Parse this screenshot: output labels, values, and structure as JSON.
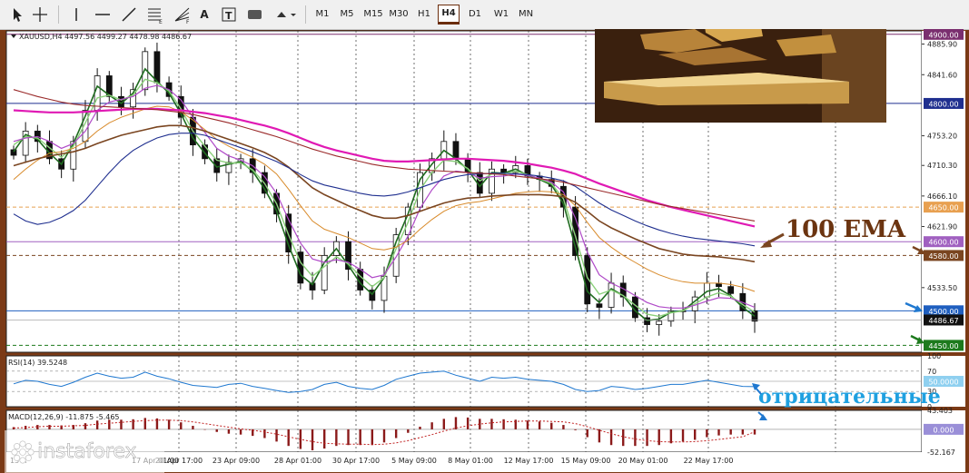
{
  "toolbar": {
    "tools": [
      "cursor-icon",
      "crosshair-icon",
      "vertical-line-icon",
      "horizontal-line-icon",
      "trendline-icon",
      "fibonacci-icon",
      "fibonacci-fan-icon",
      "text-icon",
      "text-label-icon",
      "rectangle-icon",
      "shapes-menu-icon"
    ],
    "timeframes": [
      "M1",
      "M5",
      "M15",
      "M30",
      "H1",
      "H4",
      "D1",
      "W1",
      "MN"
    ],
    "active_timeframe": "H4"
  },
  "chart_data": [
    {
      "type": "line",
      "title": "XAUUSD,H4  4497.56 4499.27 4478.98 4486.67",
      "subtitle": "",
      "xlabel": "",
      "ylabel": "",
      "ylim": [
        4440,
        4905
      ],
      "grid": true,
      "y_ticks": [
        "4900.00",
        "4885.90",
        "4841.60",
        "4800.00",
        "4753.20",
        "4710.30",
        "4666.10",
        "4650.00",
        "4621.90",
        "4600.00",
        "4580.00",
        "4533.50",
        "4500.00",
        "4486.67",
        "4450.00"
      ],
      "x_ticks": [
        "20 Apr 17:00",
        "23 Apr 09:00",
        "28 Apr 01:00",
        "30 Apr 17:00",
        "5 May 09:00",
        "8 May 01:00",
        "12 May 17:00",
        "15 May 09:00",
        "20 May 01:00",
        "22 May 17:00"
      ],
      "x_ticks_partial": [
        "15 A",
        "17 Apr 01:00"
      ],
      "horizontal_levels": [
        {
          "value": 4900,
          "label": "4900.00",
          "color": "#7a2f6f",
          "style": "solid"
        },
        {
          "value": 4800,
          "label": "4800.00",
          "color": "#1f2f8f",
          "style": "solid"
        },
        {
          "value": 4650,
          "label": "4650.00",
          "color": "#e8a050",
          "style": "dashed"
        },
        {
          "value": 4600,
          "label": "4600.00",
          "color": "#a060c0",
          "style": "solid"
        },
        {
          "value": 4580,
          "label": "4580.00",
          "color": "#7a4520",
          "style": "dashed"
        },
        {
          "value": 4500,
          "label": "4500.00",
          "color": "#1f5fbf",
          "style": "solid"
        },
        {
          "value": 4450,
          "label": "4450.00",
          "color": "#1d7a1d",
          "style": "dashed"
        }
      ],
      "current_price": {
        "value": 4486.67,
        "label": "4486.67"
      },
      "series": [
        {
          "values": [
            4725,
            4760,
            4745,
            4720,
            4705,
            4745,
            4790,
            4840,
            4810,
            4795,
            4820,
            4875,
            4830,
            4810,
            4780,
            4740,
            4720,
            4700,
            4715,
            4720,
            4700,
            4670,
            4640,
            4585,
            4540,
            4530,
            4580,
            4600,
            4560,
            4530,
            4515,
            4550,
            4610,
            4650,
            4700,
            4720,
            4745,
            4720,
            4700,
            4670,
            4705,
            4700,
            4710,
            4695,
            4690,
            4680,
            4650,
            4580,
            4510,
            4505,
            4540,
            4520,
            4490,
            4480,
            4485,
            4500,
            4500,
            4520,
            4540,
            4535,
            4525,
            4500,
            4485
          ],
          "color": "#111111"
        },
        {
          "values": [
            4730,
            4755,
            4748,
            4728,
            4712,
            4742,
            4782,
            4825,
            4812,
            4800,
            4815,
            4850,
            4832,
            4815,
            4785,
            4750,
            4728,
            4708,
            4712,
            4716,
            4702,
            4676,
            4645,
            4595,
            4552,
            4538,
            4570,
            4590,
            4566,
            4540,
            4524,
            4548,
            4600,
            4640,
            4690,
            4712,
            4732,
            4720,
            4704,
            4680,
            4700,
            4699,
            4705,
            4696,
            4690,
            4682,
            4655,
            4592,
            4528,
            4512,
            4532,
            4522,
            4500,
            4486,
            4488,
            4498,
            4500,
            4514,
            4528,
            4532,
            4522,
            4505,
            4492
          ],
          "color": "#1f6b1f"
        },
        {
          "values": [
            4740,
            4752,
            4750,
            4736,
            4722,
            4738,
            4772,
            4808,
            4812,
            4805,
            4812,
            4835,
            4830,
            4818,
            4792,
            4760,
            4738,
            4718,
            4714,
            4714,
            4704,
            4684,
            4655,
            4610,
            4570,
            4550,
            4564,
            4578,
            4568,
            4550,
            4535,
            4548,
            4590,
            4628,
            4675,
            4700,
            4718,
            4716,
            4706,
            4688,
            4698,
            4698,
            4702,
            4697,
            4691,
            4684,
            4662,
            4608,
            4548,
            4524,
            4530,
            4522,
            4508,
            4495,
            4492,
            4497,
            4500,
            4510,
            4520,
            4526,
            4521,
            4509,
            4498
          ],
          "color": "#8ad07a"
        },
        {
          "values": [
            4745,
            4750,
            4752,
            4745,
            4735,
            4742,
            4760,
            4790,
            4802,
            4806,
            4810,
            4822,
            4826,
            4820,
            4805,
            4780,
            4758,
            4735,
            4724,
            4718,
            4710,
            4694,
            4670,
            4632,
            4598,
            4575,
            4570,
            4574,
            4570,
            4560,
            4548,
            4552,
            4578,
            4608,
            4648,
            4675,
            4695,
            4702,
            4700,
            4692,
            4694,
            4695,
            4698,
            4696,
            4692,
            4686,
            4672,
            4634,
            4585,
            4552,
            4540,
            4532,
            4522,
            4512,
            4506,
            4504,
            4504,
            4508,
            4514,
            4519,
            4518,
            4512,
            4505
          ],
          "color": "#b04ac8"
        },
        {
          "values": [
            4690,
            4705,
            4718,
            4728,
            4730,
            4735,
            4745,
            4760,
            4772,
            4780,
            4786,
            4792,
            4796,
            4795,
            4788,
            4776,
            4762,
            4748,
            4738,
            4730,
            4722,
            4712,
            4698,
            4676,
            4652,
            4630,
            4618,
            4612,
            4606,
            4598,
            4590,
            4588,
            4592,
            4602,
            4618,
            4632,
            4644,
            4652,
            4656,
            4658,
            4662,
            4666,
            4670,
            4672,
            4673,
            4672,
            4668,
            4652,
            4628,
            4606,
            4592,
            4580,
            4570,
            4560,
            4552,
            4546,
            4542,
            4540,
            4540,
            4540,
            4538,
            4534,
            4528
          ],
          "color": "#d88a2a"
        },
        {
          "values": [
            4710,
            4715,
            4720,
            4724,
            4727,
            4730,
            4735,
            4742,
            4748,
            4754,
            4758,
            4762,
            4766,
            4768,
            4768,
            4765,
            4760,
            4754,
            4748,
            4742,
            4736,
            4729,
            4720,
            4708,
            4693,
            4678,
            4668,
            4660,
            4652,
            4645,
            4638,
            4634,
            4634,
            4638,
            4644,
            4650,
            4656,
            4660,
            4663,
            4664,
            4666,
            4667,
            4668,
            4668,
            4668,
            4667,
            4665,
            4657,
            4644,
            4630,
            4620,
            4612,
            4604,
            4597,
            4590,
            4586,
            4582,
            4580,
            4579,
            4578,
            4576,
            4574,
            4571
          ],
          "color": "#7a4520"
        },
        {
          "values": [
            4640,
            4630,
            4625,
            4628,
            4635,
            4645,
            4660,
            4680,
            4700,
            4718,
            4732,
            4742,
            4750,
            4755,
            4757,
            4757,
            4754,
            4748,
            4742,
            4736,
            4730,
            4723,
            4716,
            4707,
            4697,
            4688,
            4682,
            4678,
            4674,
            4670,
            4667,
            4666,
            4668,
            4672,
            4678,
            4684,
            4690,
            4694,
            4697,
            4698,
            4699,
            4699,
            4698,
            4697,
            4695,
            4692,
            4688,
            4680,
            4668,
            4656,
            4646,
            4638,
            4630,
            4623,
            4617,
            4612,
            4608,
            4605,
            4603,
            4601,
            4599,
            4597,
            4594
          ],
          "color": "#1f2f8f"
        },
        {
          "values": [
            4790,
            4789,
            4788,
            4787,
            4787,
            4787,
            4788,
            4789,
            4790,
            4791,
            4792,
            4792,
            4792,
            4791,
            4790,
            4788,
            4786,
            4783,
            4780,
            4776,
            4772,
            4768,
            4763,
            4757,
            4750,
            4743,
            4737,
            4732,
            4728,
            4724,
            4720,
            4717,
            4716,
            4716,
            4717,
            4718,
            4719,
            4720,
            4720,
            4719,
            4718,
            4717,
            4715,
            4713,
            4710,
            4707,
            4703,
            4698,
            4691,
            4684,
            4678,
            4672,
            4666,
            4660,
            4655,
            4650,
            4646,
            4642,
            4638,
            4634,
            4630,
            4626,
            4622
          ],
          "color": "#e01ab4"
        },
        {
          "values": [
            4820,
            4815,
            4810,
            4806,
            4802,
            4799,
            4797,
            4796,
            4795,
            4794,
            4793,
            4792,
            4791,
            4789,
            4787,
            4784,
            4780,
            4776,
            4772,
            4767,
            4762,
            4757,
            4752,
            4746,
            4740,
            4734,
            4729,
            4724,
            4720,
            4716,
            4712,
            4709,
            4707,
            4705,
            4704,
            4703,
            4702,
            4701,
            4700,
            4699,
            4698,
            4697,
            4695,
            4693,
            4691,
            4689,
            4686,
            4682,
            4678,
            4674,
            4670,
            4666,
            4662,
            4658,
            4654,
            4651,
            4648,
            4645,
            4642,
            4639,
            4636,
            4633,
            4630
          ],
          "color": "#9a2a2a"
        }
      ],
      "annotations": [
        "100 EMA",
        "отрицательные"
      ]
    },
    {
      "type": "line",
      "title": "RSI(14) 39.5248",
      "ylim": [
        0,
        100
      ],
      "y_ticks": [
        "100",
        "70",
        "50.0000",
        "30",
        "0"
      ],
      "series": [
        {
          "values": [
            45,
            52,
            50,
            44,
            40,
            48,
            58,
            66,
            60,
            56,
            58,
            68,
            60,
            55,
            48,
            42,
            40,
            38,
            44,
            46,
            40,
            36,
            32,
            28,
            30,
            34,
            44,
            48,
            40,
            36,
            34,
            42,
            54,
            60,
            66,
            68,
            70,
            62,
            56,
            50,
            58,
            56,
            58,
            54,
            52,
            50,
            44,
            34,
            30,
            32,
            40,
            38,
            34,
            36,
            40,
            44,
            44,
            48,
            52,
            48,
            44,
            40,
            39.5
          ],
          "color": "#1f78d0"
        }
      ]
    },
    {
      "type": "bar",
      "title": "MACD(12,26,9) -11.875 -5.465",
      "ylim": [
        -52.167,
        43.403
      ],
      "y_ticks": [
        "43.403",
        "0.000",
        "-52.167"
      ],
      "values": [
        5,
        8,
        10,
        10,
        9,
        10,
        14,
        20,
        22,
        22,
        23,
        26,
        25,
        22,
        16,
        8,
        0,
        -6,
        -10,
        -12,
        -15,
        -20,
        -28,
        -38,
        -45,
        -48,
        -44,
        -38,
        -36,
        -36,
        -36,
        -30,
        -20,
        -8,
        6,
        16,
        24,
        28,
        27,
        24,
        24,
        23,
        22,
        20,
        18,
        15,
        10,
        -2,
        -18,
        -30,
        -36,
        -38,
        -38,
        -38,
        -36,
        -32,
        -28,
        -24,
        -18,
        -14,
        -12,
        -11.9,
        -11.9
      ],
      "signal": [
        3,
        4,
        6,
        7,
        7,
        8,
        9,
        12,
        14,
        16,
        18,
        20,
        21,
        21,
        20,
        17,
        13,
        9,
        5,
        1,
        -2,
        -6,
        -11,
        -17,
        -23,
        -28,
        -32,
        -33,
        -34,
        -34,
        -35,
        -34,
        -31,
        -26,
        -19,
        -12,
        -4,
        3,
        8,
        12,
        15,
        17,
        18,
        19,
        19,
        18,
        17,
        13,
        6,
        -2,
        -10,
        -17,
        -22,
        -26,
        -28,
        -29,
        -29,
        -28,
        -26,
        -23,
        -20,
        -17,
        -5.465
      ],
      "color": "#8b1a1a"
    }
  ],
  "logo": {
    "name": "instaforex",
    "tagline": "Instant Forex Trading"
  }
}
